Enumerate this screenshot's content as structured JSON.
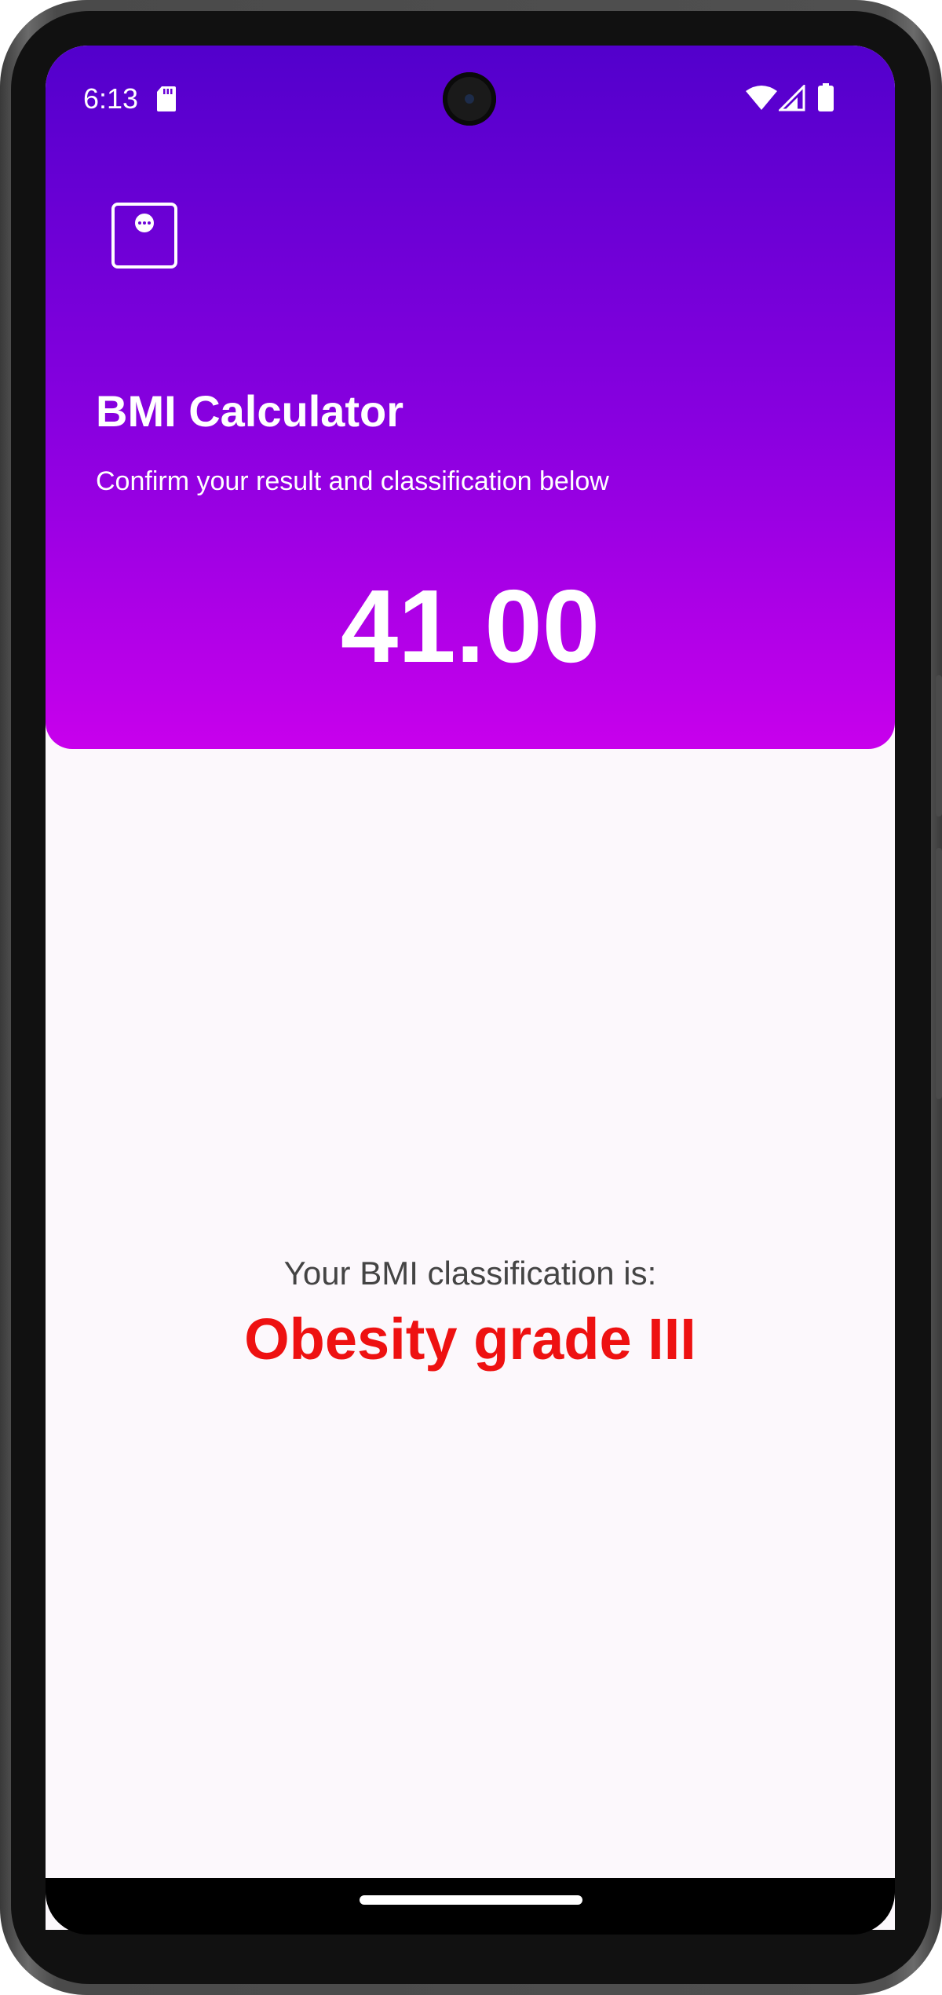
{
  "status_bar": {
    "time": "6:13"
  },
  "header": {
    "title": "BMI Calculator",
    "subtitle": "Confirm your result and classification below",
    "bmi_value": "41.00",
    "gradient_top": "#5200cc",
    "gradient_bottom": "#c800ec"
  },
  "result": {
    "label": "Your BMI classification is:",
    "classification": "Obesity grade III",
    "classification_color": "#ee1111"
  },
  "icons": {
    "menu": "more-horiz-icon",
    "sd_card": "sd-card-icon",
    "wifi": "wifi-icon",
    "signal": "signal-icon",
    "battery": "battery-icon"
  }
}
